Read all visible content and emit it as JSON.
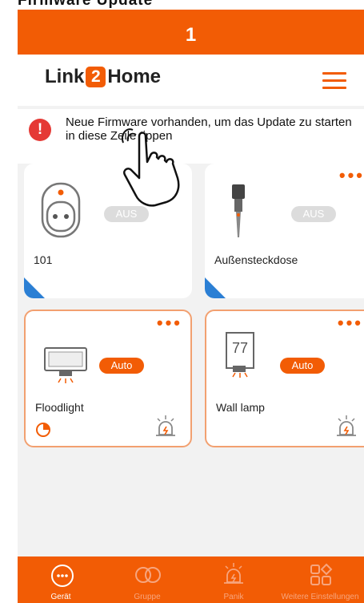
{
  "page_heading": "Firmware Update",
  "step": {
    "number": "1"
  },
  "header": {
    "logo_left": "Link",
    "logo_two": "2",
    "logo_right": "Home"
  },
  "notice": {
    "text": "Neue Firmware vorhanden, um das Update zu starten\nin diese Zeile tippen",
    "icon_symbol": "!"
  },
  "devices": [
    {
      "name": "101",
      "status": "AUS",
      "icon": "socket-icon"
    },
    {
      "name": "Außensteckdose",
      "status": "AUS",
      "icon": "outdoor-plug-icon"
    },
    {
      "name": "Floodlight",
      "status": "Auto",
      "icon": "floodlight-icon"
    },
    {
      "name": "Wall lamp",
      "status": "Auto",
      "icon": "wall-lamp-icon",
      "lamp_number": "77"
    }
  ],
  "tabs": [
    {
      "label": "Gerät",
      "icon": "device-icon",
      "active": true
    },
    {
      "label": "Gruppe",
      "icon": "group-icon",
      "active": false
    },
    {
      "label": "Panik",
      "icon": "panic-icon",
      "active": false
    },
    {
      "label": "Weitere Einstellungen",
      "icon": "settings-grid-icon",
      "active": false
    }
  ],
  "colors": {
    "accent": "#f25c05",
    "alert": "#e53935",
    "corner": "#2b7fd4"
  }
}
